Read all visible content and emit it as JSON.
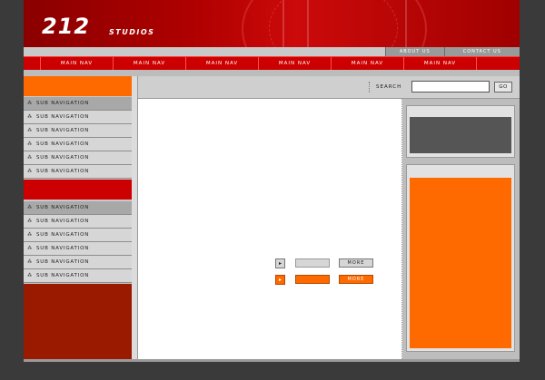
{
  "header": {
    "logo_number": "212",
    "logo_text": "STUDIOS"
  },
  "top_links": [
    "ABOUT US",
    "CONTACT US"
  ],
  "main_nav": [
    "MAIN NAV",
    "MAIN NAV",
    "MAIN NAV",
    "MAIN NAV",
    "MAIN NAV",
    "MAIN NAV"
  ],
  "sidebar": {
    "group1": [
      "SUB NAVIGATION",
      "SUB NAVIGATION",
      "SUB NAVIGATION",
      "SUB NAVIGATION",
      "SUB NAVIGATION",
      "SUB NAVIGATION"
    ],
    "group2": [
      "SUB NAVIGATION",
      "SUB NAVIGATION",
      "SUB NAVIGATION",
      "SUB NAVIGATION",
      "SUB NAVIGATION",
      "SUB NAVIGATION"
    ],
    "bullet": "⁂"
  },
  "search": {
    "label": "SEARCH",
    "value": "",
    "go_label": "GO"
  },
  "content": {
    "more1": "MORE",
    "more2": "MORE"
  },
  "colors": {
    "brand_red": "#cc0000",
    "accent_orange": "#ff6a00",
    "dark_red": "#9a1a00"
  }
}
